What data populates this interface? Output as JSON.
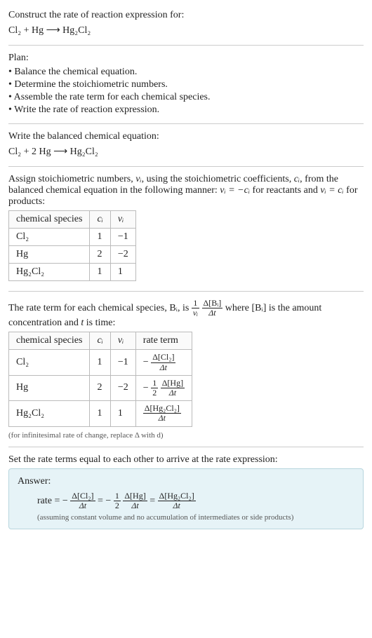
{
  "intro": {
    "prompt": "Construct the rate of reaction expression for:",
    "equation": "Cl₂ + Hg ⟶ Hg₂Cl₂"
  },
  "plan": {
    "heading": "Plan:",
    "items": [
      "• Balance the chemical equation.",
      "• Determine the stoichiometric numbers.",
      "• Assemble the rate term for each chemical species.",
      "• Write the rate of reaction expression."
    ]
  },
  "balanced": {
    "heading": "Write the balanced chemical equation:",
    "equation": "Cl₂ + 2 Hg ⟶ Hg₂Cl₂"
  },
  "stoich": {
    "intro_pre": "Assign stoichiometric numbers, ",
    "intro_nu": "νᵢ",
    "intro_mid1": ", using the stoichiometric coefficients, ",
    "intro_c": "cᵢ",
    "intro_mid2": ", from the balanced chemical equation in the following manner: ",
    "intro_eq1": "νᵢ = −cᵢ",
    "intro_mid3": " for reactants and ",
    "intro_eq2": "νᵢ = cᵢ",
    "intro_end": " for products:",
    "headers": {
      "species": "chemical species",
      "c": "cᵢ",
      "nu": "νᵢ"
    },
    "rows": [
      {
        "species": "Cl₂",
        "c": "1",
        "nu": "−1"
      },
      {
        "species": "Hg",
        "c": "2",
        "nu": "−2"
      },
      {
        "species": "Hg₂Cl₂",
        "c": "1",
        "nu": "1"
      }
    ]
  },
  "rateterm": {
    "intro_pre": "The rate term for each chemical species, ",
    "intro_B": "Bᵢ",
    "intro_mid1": ", is ",
    "frac1_num": "1",
    "frac1_den": "νᵢ",
    "frac2_num": "Δ[Bᵢ]",
    "frac2_den": "Δt",
    "intro_mid2": " where ",
    "intro_Bi": "[Bᵢ]",
    "intro_mid3": " is the amount concentration and ",
    "intro_t": "t",
    "intro_end": " is time:",
    "headers": {
      "species": "chemical species",
      "c": "cᵢ",
      "nu": "νᵢ",
      "rate": "rate term"
    },
    "rows": [
      {
        "species": "Cl₂",
        "c": "1",
        "nu": "−1",
        "rate_prefix": "−",
        "rate_coef_num": "",
        "rate_coef_den": "",
        "rate_num": "Δ[Cl₂]",
        "rate_den": "Δt"
      },
      {
        "species": "Hg",
        "c": "2",
        "nu": "−2",
        "rate_prefix": "−",
        "rate_coef_num": "1",
        "rate_coef_den": "2",
        "rate_num": "Δ[Hg]",
        "rate_den": "Δt"
      },
      {
        "species": "Hg₂Cl₂",
        "c": "1",
        "nu": "1",
        "rate_prefix": "",
        "rate_coef_num": "",
        "rate_coef_den": "",
        "rate_num": "Δ[Hg₂Cl₂]",
        "rate_den": "Δt"
      }
    ],
    "note": "(for infinitesimal rate of change, replace Δ with d)"
  },
  "final": {
    "heading": "Set the rate terms equal to each other to arrive at the rate expression:"
  },
  "answer": {
    "title": "Answer:",
    "rate_label": "rate = ",
    "note": "(assuming constant volume and no accumulation of intermediates or side products)"
  },
  "chart_data": {
    "type": "table",
    "tables": [
      {
        "title": "Stoichiometric numbers",
        "columns": [
          "chemical species",
          "c_i",
          "ν_i"
        ],
        "rows": [
          [
            "Cl2",
            1,
            -1
          ],
          [
            "Hg",
            2,
            -2
          ],
          [
            "Hg2Cl2",
            1,
            1
          ]
        ]
      },
      {
        "title": "Rate terms",
        "columns": [
          "chemical species",
          "c_i",
          "ν_i",
          "rate term"
        ],
        "rows": [
          [
            "Cl2",
            1,
            -1,
            "-(Δ[Cl2]/Δt)"
          ],
          [
            "Hg",
            2,
            -2,
            "-(1/2)(Δ[Hg]/Δt)"
          ],
          [
            "Hg2Cl2",
            1,
            1,
            "(Δ[Hg2Cl2]/Δt)"
          ]
        ]
      }
    ],
    "balanced_equation": "Cl2 + 2 Hg -> Hg2Cl2",
    "rate_expression": "rate = -(Δ[Cl2]/Δt) = -(1/2)(Δ[Hg]/Δt) = (Δ[Hg2Cl2]/Δt)"
  }
}
